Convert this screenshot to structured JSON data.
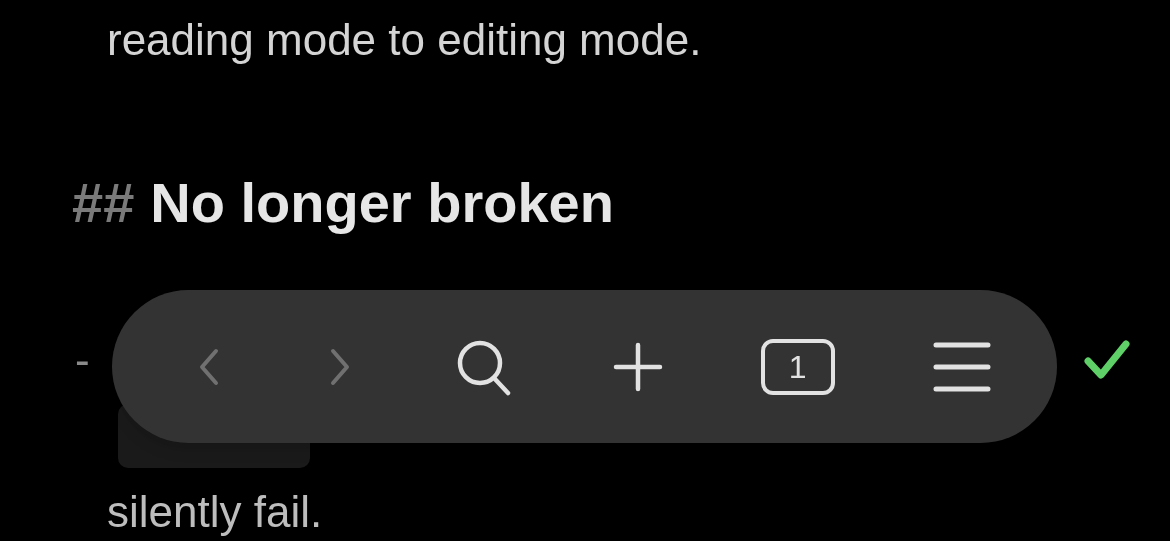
{
  "paragraph": "reading mode to editing mode.",
  "heading": {
    "marker": "##",
    "text": "No longer broken"
  },
  "list_item": {
    "marker": "-",
    "done": true,
    "lines": [
      {
        "code_block": true
      },
      {
        "text": "silently fail."
      }
    ]
  },
  "toolbar": {
    "buttons": [
      {
        "kind": "back",
        "disabled": true
      },
      {
        "kind": "forward",
        "disabled": true
      },
      {
        "kind": "search",
        "disabled": false
      },
      {
        "kind": "new",
        "disabled": false
      },
      {
        "kind": "tabs",
        "disabled": false,
        "count": "1"
      },
      {
        "kind": "menu",
        "disabled": false
      }
    ]
  }
}
